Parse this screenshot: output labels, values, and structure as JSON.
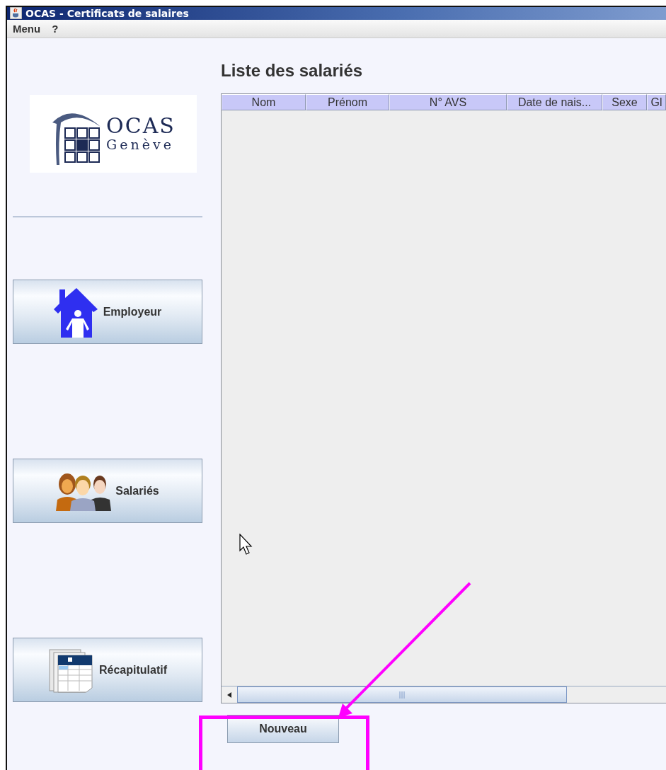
{
  "window": {
    "title": "OCAS - Certificats de salaires"
  },
  "menu": [
    "Menu",
    "?"
  ],
  "logo": {
    "name": "OCAS",
    "subtitle": "Genève"
  },
  "sidebar": [
    {
      "kind": "employer",
      "label": "Employeur"
    },
    {
      "kind": "employees",
      "label": "Salariés"
    },
    {
      "kind": "summary",
      "label": "Récapitulatif"
    }
  ],
  "heading": "Liste des salariés",
  "table": {
    "columns": [
      "Nom",
      "Prénom",
      "N° AVS",
      "Date de nais...",
      "Sexe",
      "Gl"
    ]
  },
  "buttons": [
    "Nouveau"
  ]
}
